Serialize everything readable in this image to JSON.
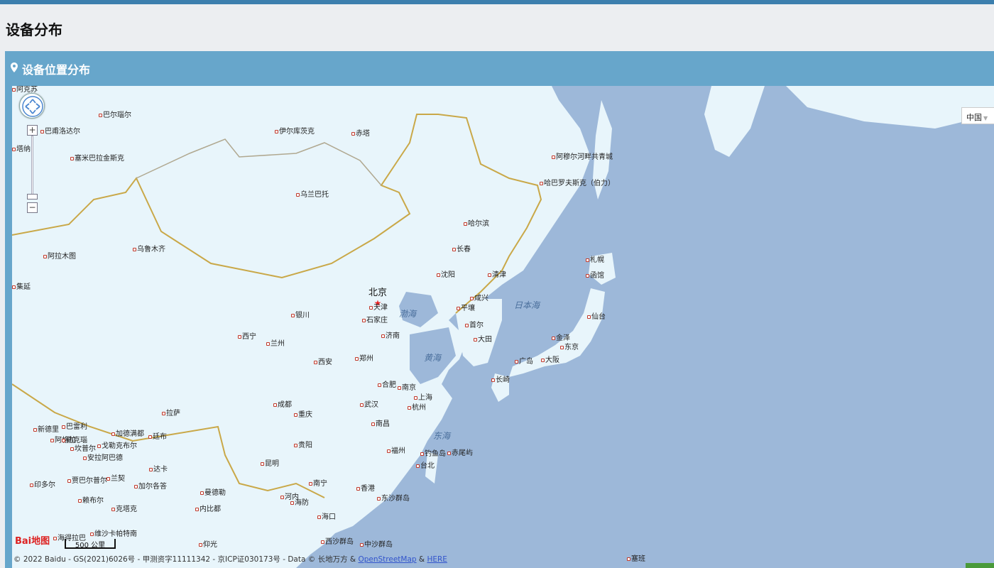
{
  "page": {
    "title": "设备分布"
  },
  "panel": {
    "title": "设备位置分布",
    "pin_icon": "map-marker-icon"
  },
  "map": {
    "country_select": "中国",
    "zoom_in": "+",
    "zoom_out": "−",
    "scale": "500 公里",
    "logo": "Bai地图",
    "copyright_prefix": "© 2022 Baidu - GS(2021)6026号 - 甲测资字11111342 - 京ICP证030173号 - Data © 长地万方 & ",
    "osm_link": "OpenStreetMap",
    "amp": " & ",
    "here_link": "HERE",
    "capital": "北京",
    "colors": {
      "land": "#e8f5fb",
      "sea": "#9db8d9",
      "border": "#c9a848"
    },
    "seas": [
      {
        "name": "渤海"
      },
      {
        "name": "黄海"
      },
      {
        "name": "东海"
      },
      {
        "name": "日本海"
      }
    ],
    "cities": [
      "巴尔瑙尔",
      "巴甫洛达尔",
      "塞米巴拉金斯克",
      "伊尔库茨克",
      "赤塔",
      "阿穆尔河畔共青城",
      "哈巴罗夫斯克（伯力）",
      "乌兰巴托",
      "哈尔滨",
      "长春",
      "乌鲁木齐",
      "阿拉木图",
      "沈阳",
      "清津",
      "札幌",
      "函馆",
      "天津",
      "石家庄",
      "平壤",
      "咸兴",
      "首尔",
      "银川",
      "济南",
      "西宁",
      "兰州",
      "仙台",
      "金泽",
      "东京",
      "大田",
      "郑州",
      "西安",
      "广岛",
      "大阪",
      "长崎",
      "合肥",
      "南京",
      "上海",
      "成都",
      "武汉",
      "杭州",
      "重庆",
      "拉萨",
      "南昌",
      "新德里",
      "巴雷利",
      "加德满都",
      "廷布",
      "阿格拉",
      "坎普尔",
      "戈勒克布尔",
      "安拉阿巴德",
      "贵阳",
      "福州",
      "钓鱼岛",
      "赤尾屿",
      "台北",
      "昆明",
      "勒克瑙",
      "达卡",
      "印多尔",
      "贾巴尔普尔",
      "兰契",
      "加尔各答",
      "曼德勒",
      "南宁",
      "香港",
      "河内",
      "海防",
      "内比都",
      "赖布尔",
      "克塔克",
      "海口",
      "东沙群岛",
      "维沙卡帕特南",
      "海得拉巴",
      "仰光",
      "西沙群岛",
      "中沙群岛",
      "塞班",
      "阿克苏",
      "集延",
      "塔纳"
    ]
  }
}
